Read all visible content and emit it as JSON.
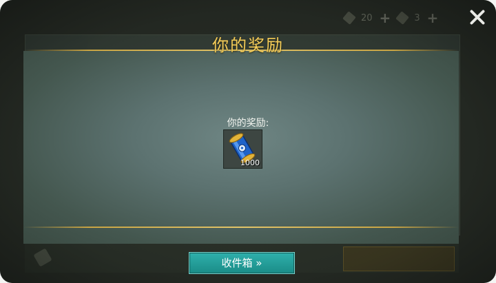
{
  "top_bar": {
    "wrench_count": "20",
    "hammer_count": "3"
  },
  "modal": {
    "title": "你的奖励",
    "reward_label": "你的奖励:",
    "reward_item": {
      "icon": "blue-scroll-icon",
      "quantity": "1000"
    },
    "collect_button": "收件箱 »"
  },
  "colors": {
    "title_gold": "#f4cc59",
    "button_teal": "#1f9e99"
  }
}
